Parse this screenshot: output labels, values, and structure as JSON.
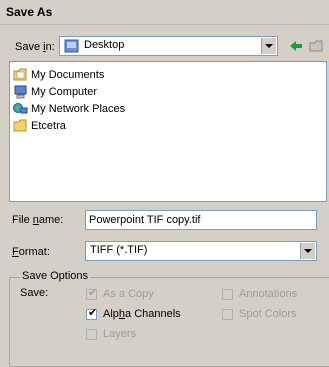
{
  "window": {
    "title": "Save As"
  },
  "save_in": {
    "label": "Save in:",
    "accel": "i",
    "value": "Desktop"
  },
  "files": [
    {
      "name": "My Documents",
      "icon": "my-documents-icon"
    },
    {
      "name": "My Computer",
      "icon": "my-computer-icon"
    },
    {
      "name": "My Network Places",
      "icon": "network-places-icon"
    },
    {
      "name": "Etcetra",
      "icon": "folder-icon"
    }
  ],
  "file_name": {
    "label": "File name:",
    "value": "Powerpoint TIF copy.tif"
  },
  "format": {
    "label": "Format:",
    "value": "TIFF (*.TIF)"
  },
  "save_options": {
    "legend": "Save Options",
    "save_label": "Save:",
    "as_copy": {
      "label": "As a Copy",
      "checked": true,
      "enabled": false
    },
    "annotations": {
      "label": "Annotations",
      "checked": false,
      "enabled": false
    },
    "alpha_channels": {
      "label": "Alpha Channels",
      "checked": true,
      "enabled": true
    },
    "spot_colors": {
      "label": "Spot Colors",
      "checked": false,
      "enabled": false
    },
    "layers": {
      "label": "Layers",
      "checked": false,
      "enabled": false
    }
  }
}
